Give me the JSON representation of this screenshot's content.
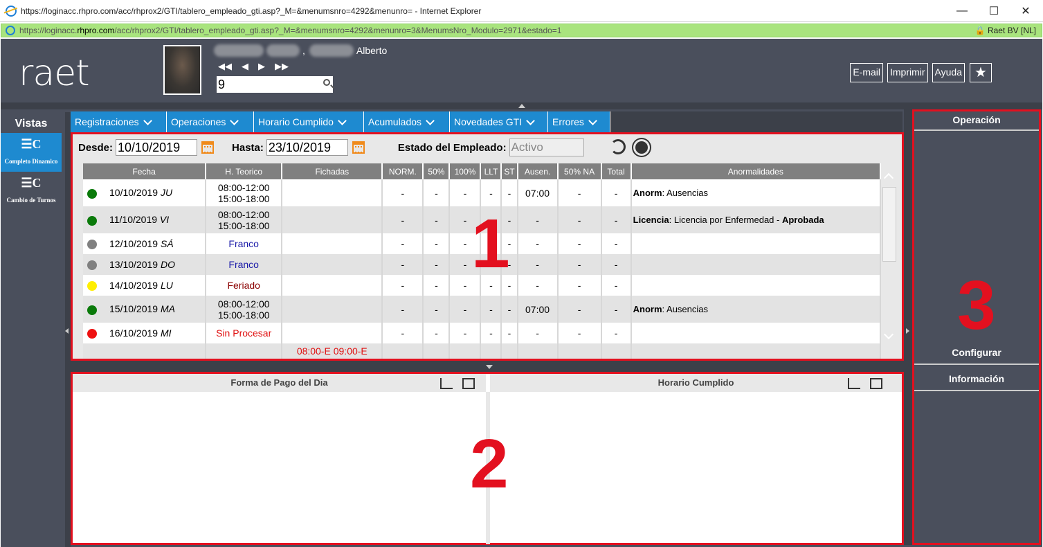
{
  "browser": {
    "title": "https://loginacc.rhpro.com/acc/rhprox2/GTI/tablero_empleado_gti.asp?_M=&menumsnro=4292&menunro= - Internet Explorer",
    "url_prefix": "https://loginacc.",
    "url_domain": "rhpro.com",
    "url_rest": "/acc/rhprox2/GTI/tablero_empleado_gti.asp?_M=&menumsnro=4292&menunro=3&MenumsNro_Modulo=2971&estado=1",
    "cert": "Raet BV [NL]"
  },
  "header": {
    "logo": "raet",
    "employee_first": "Alberto",
    "employee_search_value": "9",
    "buttons": [
      "E-mail",
      "Imprimir",
      "Ayuda"
    ]
  },
  "left": {
    "title": "Vistas",
    "views": [
      {
        "label": "Completo Dinamico"
      },
      {
        "label": "Cambio de Turnos"
      }
    ]
  },
  "menu": {
    "items": [
      "Registraciones",
      "Operaciones",
      "Horario Cumplido",
      "Acumulados",
      "Novedades GTI",
      "Errores"
    ]
  },
  "filters": {
    "desde_label": "Desde:",
    "desde_value": "10/10/2019",
    "hasta_label": "Hasta:",
    "hasta_value": "23/10/2019",
    "estado_label": "Estado del Empleado:",
    "estado_value": "Activo"
  },
  "table": {
    "headers": [
      "Fecha",
      "H. Teorico",
      "Fichadas",
      "NORM.",
      "50%",
      "100%",
      "LLT",
      "ST",
      "Ausen.",
      "50% NA",
      "Total",
      "Anormalidades"
    ],
    "rows": [
      {
        "dot": "#0a7a0a",
        "date": "10/10/2019",
        "day": "JU",
        "h1": "08:00-12:00",
        "h2": "15:00-18:00",
        "fich": "",
        "norm": "-",
        "p50": "-",
        "p100": "-",
        "llt": "-",
        "st": "-",
        "ausen": "07:00",
        "na": "-",
        "total": "-",
        "anom_b": "Anorm",
        "anom": ": Ausencias",
        "anom_b2": ""
      },
      {
        "dot": "#0a7a0a",
        "date": "11/10/2019",
        "day": "VI",
        "h1": "08:00-12:00",
        "h2": "15:00-18:00",
        "fich": "",
        "norm": "-",
        "p50": "-",
        "p100": "-",
        "llt": "-",
        "st": "-",
        "ausen": "-",
        "na": "-",
        "total": "-",
        "anom_b": "Licencia",
        "anom": ": Licencia por Enfermedad - ",
        "anom_b2": "Aprobada"
      },
      {
        "dot": "#808080",
        "date": "12/10/2019",
        "day": "SÁ",
        "label": "Franco",
        "fich": "",
        "norm": "-",
        "p50": "-",
        "p100": "-",
        "llt": "-",
        "st": "-",
        "ausen": "-",
        "na": "-",
        "total": "-"
      },
      {
        "dot": "#808080",
        "date": "13/10/2019",
        "day": "DO",
        "label": "Franco",
        "fich": "",
        "norm": "-",
        "p50": "-",
        "p100": "-",
        "llt": "-",
        "st": "-",
        "ausen": "-",
        "na": "-",
        "total": "-"
      },
      {
        "dot": "#ffee00",
        "date": "14/10/2019",
        "day": "LU",
        "label": "Feriado",
        "fich": "",
        "norm": "-",
        "p50": "-",
        "p100": "-",
        "llt": "-",
        "st": "-",
        "ausen": "-",
        "na": "-",
        "total": "-"
      },
      {
        "dot": "#0a7a0a",
        "date": "15/10/2019",
        "day": "MA",
        "h1": "08:00-12:00",
        "h2": "15:00-18:00",
        "fich": "",
        "norm": "-",
        "p50": "-",
        "p100": "-",
        "llt": "-",
        "st": "-",
        "ausen": "07:00",
        "na": "-",
        "total": "-",
        "anom_b": "Anorm",
        "anom": ": Ausencias",
        "anom_b2": ""
      },
      {
        "dot": "#ee1111",
        "date": "16/10/2019",
        "day": "MI",
        "label": "Sin Procesar",
        "fich": "",
        "norm": "-",
        "p50": "-",
        "p100": "-",
        "llt": "-",
        "st": "-",
        "ausen": "-",
        "na": "-",
        "total": "-"
      }
    ],
    "partial_fichadas": "08:00-E 09:00-E"
  },
  "bottom": {
    "left_title": "Forma de Pago del Dia",
    "right_title": "Horario Cumplido"
  },
  "right": {
    "operacion": "Operación",
    "configurar": "Configurar",
    "informacion": "Información"
  },
  "annotations": {
    "n1": "1",
    "n2": "2",
    "n3": "3"
  }
}
